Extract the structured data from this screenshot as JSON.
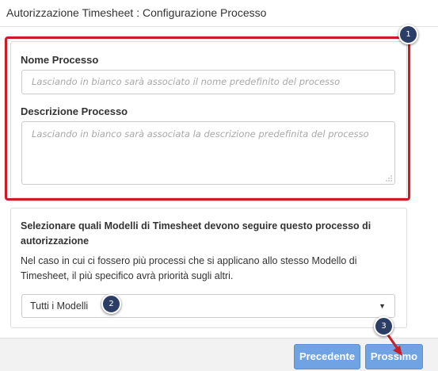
{
  "dialog": {
    "title": "Autorizzazione Timesheet : Configurazione Processo"
  },
  "process": {
    "name_label": "Nome Processo",
    "name_placeholder": "Lasciando in bianco sarà associato il nome predefinito del processo",
    "description_label": "Descrizione Processo",
    "description_placeholder": "Lasciando in bianco sarà associata la descrizione predefinita del processo"
  },
  "models": {
    "title": "Selezionare quali Modelli di Timesheet devono seguire questo processo di autorizzazione",
    "description": "Nel caso in cui ci fossero più processi che si applicano allo stesso Modello di Timesheet, il più specifico avrà priorità sugli altri.",
    "selected": "Tutti i Modelli"
  },
  "footer": {
    "prev_label": "Precedente",
    "next_label": "Prossimo"
  },
  "annotations": {
    "step1": "1",
    "step2": "2",
    "step3": "3",
    "highlight_color": "#c81e2a",
    "badge_color": "#2c3e66"
  },
  "colors": {
    "button": "#6fa3e3",
    "footer_bg": "#f2f2f2"
  },
  "icons": {
    "select_caret": "caret-down-icon",
    "resize": "resize-grip-icon"
  }
}
